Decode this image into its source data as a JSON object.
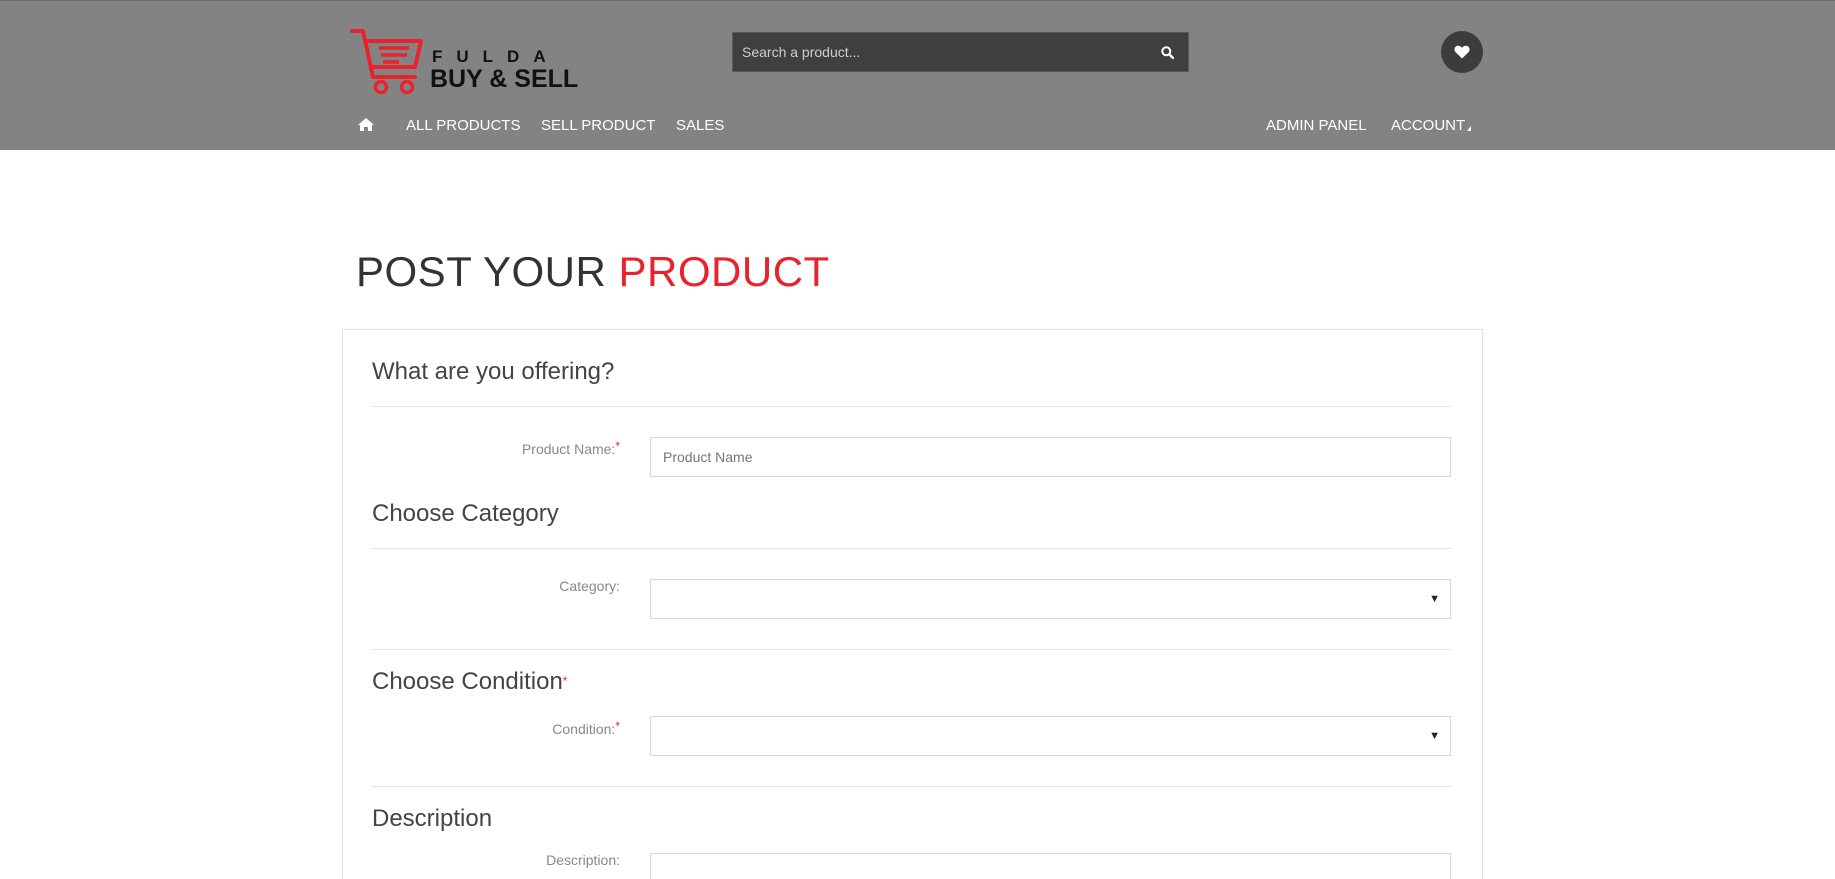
{
  "header": {
    "logo": {
      "brand_top": "FULDA",
      "brand_bottom": "BUY & SELL",
      "accent_color": "#e8232d"
    },
    "search": {
      "placeholder": "Search a product...",
      "icon": "search-icon"
    },
    "wishlist_icon": "heart-icon",
    "nav": {
      "home_icon": "home-icon",
      "items": [
        "ALL PRODUCTS",
        "SELL PRODUCT",
        "SALES"
      ],
      "admin": "ADMIN PANEL",
      "account": "ACCOUNT"
    },
    "background": "#838383"
  },
  "page": {
    "title_part1": "POST YOUR",
    "title_part2": "PRODUCT",
    "accent": "#e8232d"
  },
  "form": {
    "section_offering": "What are you offering?",
    "product_name_label": "Product Name:",
    "product_name_placeholder": "Product Name",
    "section_category": "Choose Category",
    "category_label": "Category:",
    "category_value": "",
    "section_condition": "Choose Condition",
    "condition_label": "Condition:",
    "condition_value": "",
    "section_description": "Description",
    "description_label": "Description:",
    "required_mark": "*"
  }
}
